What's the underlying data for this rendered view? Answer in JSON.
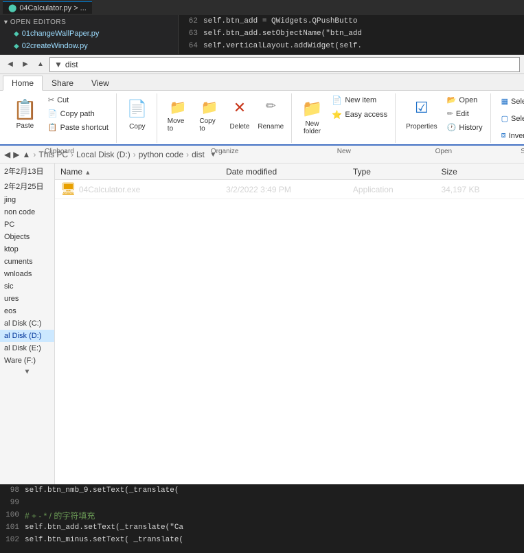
{
  "editor_top": {
    "open_editors_label": "OPEN EDITORS",
    "files": [
      {
        "name": "01changeWallPaper.py",
        "icon": "●"
      },
      {
        "name": "02createWindow.py",
        "icon": "●"
      }
    ],
    "active_tab": "04Calculator.py > ...",
    "lines": [
      {
        "num": "62",
        "code": "self.btn_add = QWidgets.QPushButto"
      },
      {
        "num": "63",
        "code": "self.btn_add.setObjectName(\"btn_add"
      },
      {
        "num": "64",
        "code": "self.verticalLayout.addWidget(self."
      }
    ]
  },
  "address_bar": {
    "path": "dist"
  },
  "ribbon_tabs": [
    "Home",
    "Share",
    "View"
  ],
  "active_tab": "Home",
  "clipboard_group": {
    "label": "Clipboard",
    "paste_label": "Paste",
    "cut_label": "Cut",
    "copy_path_label": "Copy path",
    "paste_shortcut_label": "Paste shortcut",
    "copy_label": "Copy"
  },
  "organize_group": {
    "label": "Organize",
    "move_to_label": "Move to",
    "copy_to_label": "Copy to",
    "delete_label": "Delete",
    "rename_label": "Rename"
  },
  "new_group": {
    "label": "New",
    "new_folder_label": "New folder",
    "new_item_label": "New item",
    "easy_access_label": "Easy access"
  },
  "open_group": {
    "label": "Open",
    "open_label": "Open",
    "edit_label": "Edit",
    "history_label": "History",
    "properties_label": "Properties"
  },
  "select_group": {
    "label": "Select",
    "select_all_label": "Select all",
    "select_none_label": "Select none",
    "invert_selection_label": "Invert selection"
  },
  "breadcrumb": {
    "items": [
      "This PC",
      "Local Disk (D:)",
      "python code",
      "dist"
    ]
  },
  "sidebar": {
    "items": [
      {
        "label": "2年2月13日",
        "active": false
      },
      {
        "label": "2年2月25日",
        "active": false
      },
      {
        "label": "jing",
        "active": false
      },
      {
        "label": "non code",
        "active": false
      },
      {
        "label": "PC",
        "active": false
      },
      {
        "label": "Objects",
        "active": false
      },
      {
        "label": "ktop",
        "active": false
      },
      {
        "label": "cuments",
        "active": false
      },
      {
        "label": "wnloads",
        "active": false
      },
      {
        "label": "sic",
        "active": false
      },
      {
        "label": "ures",
        "active": false
      },
      {
        "label": "eos",
        "active": false
      },
      {
        "label": "al Disk (C:)",
        "active": false
      },
      {
        "label": "al Disk (D:)",
        "active": true
      },
      {
        "label": "al Disk (E:)",
        "active": false
      },
      {
        "label": "Ware (F:)",
        "active": false
      }
    ]
  },
  "file_list": {
    "headers": [
      "Name",
      "Date modified",
      "Type",
      "Size"
    ],
    "files": [
      {
        "name": "04Calculator.exe",
        "date": "3/2/2022 3:49 PM",
        "type": "Application",
        "size": "34,197 KB"
      }
    ]
  },
  "editor_bottom": {
    "lines": [
      {
        "num": "98",
        "code": "self.btn_nmb_9.setText(_translate("
      },
      {
        "num": "99",
        "code": ""
      },
      {
        "num": "100",
        "code": "# + - * / 的字符填充",
        "is_comment": true
      },
      {
        "num": "101",
        "code": "self.btn_add.setText(_translate(\"Ca"
      },
      {
        "num": "102",
        "code": "self.btn_minus.setText( _translate("
      }
    ]
  }
}
